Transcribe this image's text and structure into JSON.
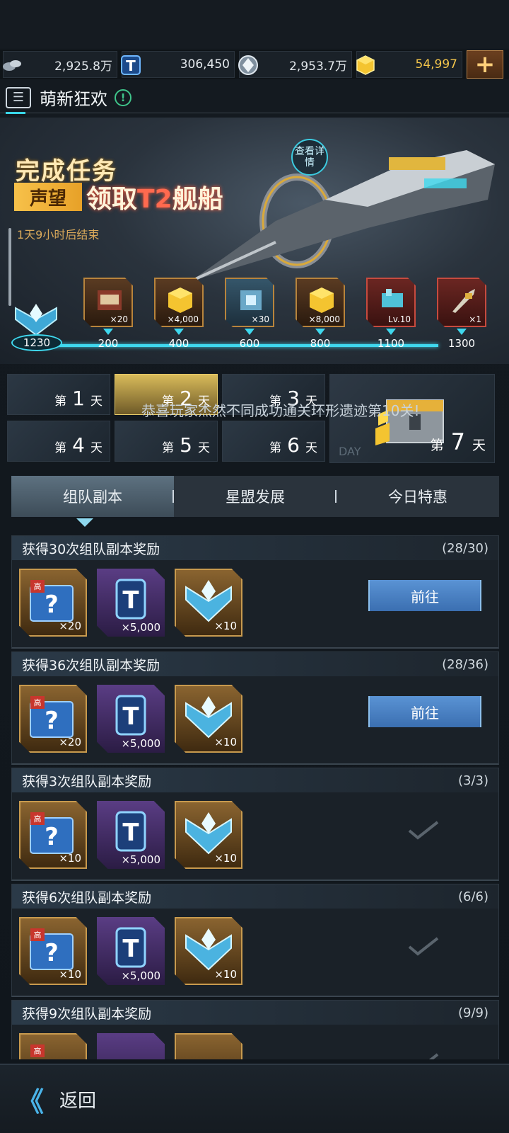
{
  "resources": [
    {
      "icon": "ore-icon",
      "value": "2,925.8万"
    },
    {
      "icon": "t-coin-icon",
      "value": "306,450"
    },
    {
      "icon": "crystal-icon",
      "value": "2,953.7万"
    },
    {
      "icon": "gold-cube-icon",
      "value": "54,997"
    }
  ],
  "header": {
    "title": "萌新狂欢",
    "info_glyph": "!"
  },
  "banner": {
    "headline1": "完成任务",
    "tag": "声望",
    "headline2_pre": "领取",
    "headline2_t2": "T2",
    "headline2_post": "舰船",
    "end_time": "1天9小时后结束",
    "view_details": "查看详情",
    "rank_value": "1230",
    "rewards": [
      {
        "count": "×20",
        "milestone": "200",
        "color": "gold"
      },
      {
        "count": "×4,000",
        "milestone": "400",
        "color": "gold"
      },
      {
        "count": "×30",
        "milestone": "600",
        "color": "gold"
      },
      {
        "count": "×8,000",
        "milestone": "800",
        "color": "gold"
      },
      {
        "count": "Lv.10",
        "milestone": "1100",
        "color": "red"
      },
      {
        "count": "×1",
        "milestone": "1300",
        "color": "red"
      }
    ]
  },
  "days": {
    "prefix": "第",
    "suffix": "天",
    "items": [
      "1",
      "2",
      "3",
      "4",
      "5",
      "6",
      "7"
    ],
    "day7_watermark": "DAY",
    "marquee": "恭喜玩家杰然不同成功通关环形遗迹第10关!"
  },
  "tabs": [
    "组队副本",
    "星盟发展",
    "今日特惠"
  ],
  "tasks": [
    {
      "name": "获得30次组队副本奖励",
      "progress": "(28/30)",
      "items": [
        "×20",
        "×5,000",
        "×10"
      ],
      "state": "goto"
    },
    {
      "name": "获得36次组队副本奖励",
      "progress": "(28/36)",
      "items": [
        "×20",
        "×5,000",
        "×10"
      ],
      "state": "goto"
    },
    {
      "name": "获得3次组队副本奖励",
      "progress": "(3/3)",
      "items": [
        "×10",
        "×5,000",
        "×10"
      ],
      "state": "done"
    },
    {
      "name": "获得6次组队副本奖励",
      "progress": "(6/6)",
      "items": [
        "×10",
        "×5,000",
        "×10"
      ],
      "state": "done"
    },
    {
      "name": "获得9次组队副本奖励",
      "progress": "(9/9)",
      "items": [
        "",
        "",
        ""
      ],
      "state": "done"
    }
  ],
  "labels": {
    "goto": "前往",
    "high": "高",
    "back": "返回",
    "t_glyph": "T",
    "q_glyph": "?"
  },
  "colors": {
    "accent_cyan": "#3fd8ee",
    "gold": "#f3c54b",
    "button_blue": "#4a85c8"
  }
}
